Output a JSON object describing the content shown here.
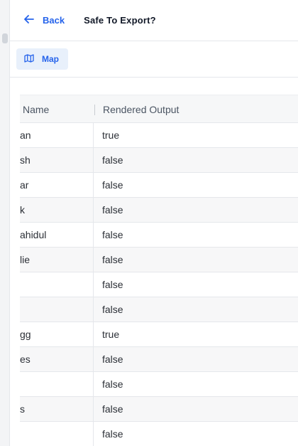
{
  "header": {
    "back_label": "Back",
    "title": "Safe To Export?"
  },
  "toolbar": {
    "map_label": "Map"
  },
  "table": {
    "columns": [
      "Name",
      "Rendered Output"
    ],
    "rows": [
      {
        "name": "an",
        "output": "true"
      },
      {
        "name": "sh",
        "output": "false"
      },
      {
        "name": "ar",
        "output": "false"
      },
      {
        "name": "k",
        "output": "false"
      },
      {
        "name": "ahidul",
        "output": "false"
      },
      {
        "name": "lie",
        "output": "false"
      },
      {
        "name": "",
        "output": "false"
      },
      {
        "name": "",
        "output": "false"
      },
      {
        "name": "gg",
        "output": "true"
      },
      {
        "name": "es",
        "output": "false"
      },
      {
        "name": "",
        "output": "false"
      },
      {
        "name": "s",
        "output": "false"
      },
      {
        "name": "",
        "output": "false"
      }
    ]
  },
  "colors": {
    "accent": "#2563eb",
    "button_bg": "#e8f0fb",
    "border": "#e5e7eb",
    "row_alt": "#f7f7f8"
  },
  "icons": {
    "back": "arrow-left-icon",
    "map": "map-icon"
  }
}
